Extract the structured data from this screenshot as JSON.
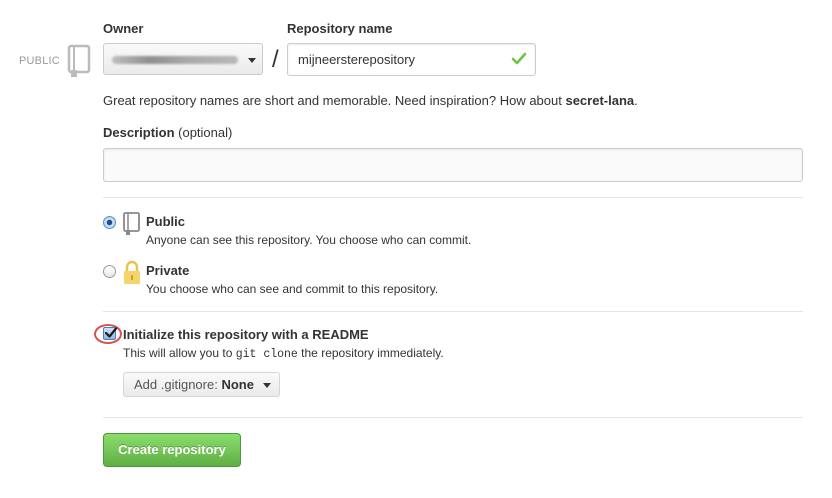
{
  "side": {
    "visibility_label": "PUBLIC"
  },
  "owner": {
    "label": "Owner"
  },
  "repo": {
    "label": "Repository name",
    "value": "mijneersterepository",
    "separator": "/"
  },
  "hint": {
    "prefix": "Great repository names are short and memorable. Need inspiration? How about ",
    "suggestion": "secret-lana",
    "suffix": "."
  },
  "description": {
    "label": "Description",
    "optional": "(optional)",
    "value": ""
  },
  "visibility": {
    "public": {
      "title": "Public",
      "desc": "Anyone can see this repository. You choose who can commit.",
      "selected": true
    },
    "private": {
      "title": "Private",
      "desc": "You choose who can see and commit to this repository.",
      "selected": false
    }
  },
  "readme": {
    "label": "Initialize this repository with a README",
    "desc_prefix": "This will allow you to ",
    "desc_code": "git clone",
    "desc_suffix": " the repository immediately.",
    "checked": true
  },
  "gitignore": {
    "prefix": "Add .gitignore:",
    "value": "None"
  },
  "create": {
    "label": "Create repository"
  },
  "colors": {
    "create_button": "#60b044",
    "valid_check": "#6cc644",
    "highlight_ring": "#d9534f",
    "lock": "#e8c34a"
  }
}
